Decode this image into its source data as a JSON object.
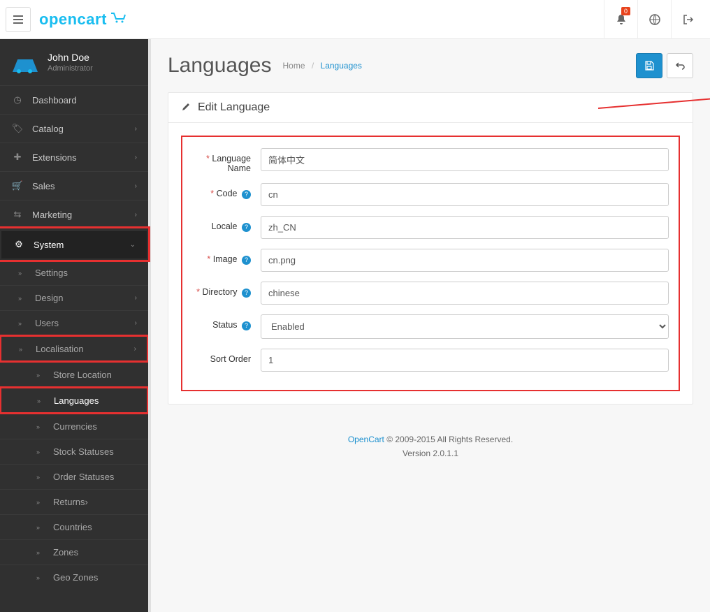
{
  "topbar": {
    "logo_text": "opencart",
    "notification_count": "0"
  },
  "profile": {
    "name": "John Doe",
    "role": "Administrator"
  },
  "nav": {
    "dashboard": "Dashboard",
    "catalog": "Catalog",
    "extensions": "Extensions",
    "sales": "Sales",
    "marketing": "Marketing",
    "system": "System",
    "settings": "Settings",
    "design": "Design",
    "users": "Users",
    "localisation": "Localisation",
    "store_location": "Store Location",
    "languages": "Languages",
    "currencies": "Currencies",
    "stock_statuses": "Stock Statuses",
    "order_statuses": "Order Statuses",
    "returns": "Returns",
    "countries": "Countries",
    "zones": "Zones",
    "geo_zones": "Geo Zones"
  },
  "page": {
    "title": "Languages",
    "breadcrumb_home": "Home",
    "breadcrumb_current": "Languages"
  },
  "panel": {
    "title": "Edit Language"
  },
  "form": {
    "labels": {
      "language_name": "Language Name",
      "code": "Code",
      "locale": "Locale",
      "image": "Image",
      "directory": "Directory",
      "status": "Status",
      "sort_order": "Sort Order"
    },
    "values": {
      "language_name": "简体中文",
      "code": "cn",
      "locale": "zh_CN",
      "image": "cn.png",
      "directory": "chinese",
      "status": "Enabled",
      "sort_order": "1"
    }
  },
  "footer": {
    "link": "OpenCart",
    "rights": " © 2009-2015 All Rights Reserved.",
    "version": "Version 2.0.1.1"
  }
}
